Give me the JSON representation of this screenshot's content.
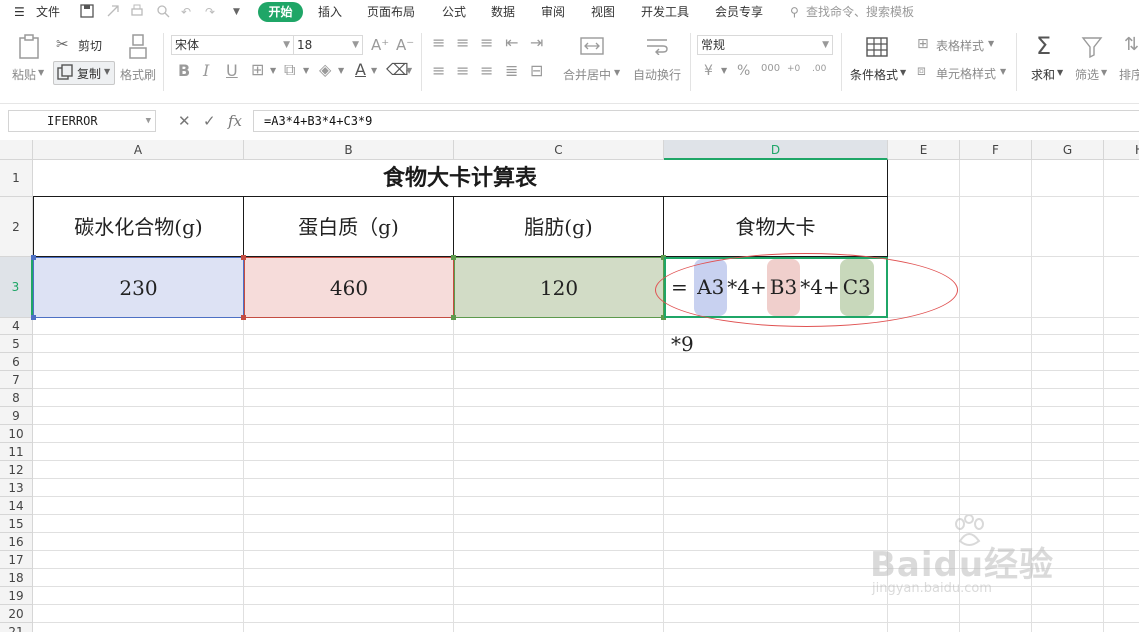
{
  "menu": {
    "file_label": "文件",
    "tabs": [
      "开始",
      "插入",
      "页面布局",
      "公式",
      "数据",
      "审阅",
      "视图",
      "开发工具",
      "会员专享"
    ],
    "search_placeholder": "查找命令、搜索模板"
  },
  "ribbon": {
    "paste": "粘贴",
    "cut": "剪切",
    "copy": "复制",
    "format_painter": "格式刷",
    "font_name": "宋体",
    "font_size": "18",
    "merge_center": "合并居中",
    "wrap_text": "自动换行",
    "number_format": "常规",
    "conditional_format": "条件格式",
    "table_style": "表格样式",
    "cell_style": "单元格样式",
    "sum": "求和",
    "filter": "筛选",
    "sort": "排序"
  },
  "formula_bar": {
    "name_box": "IFERROR",
    "fx": "fx",
    "formula": "=A3*4+B3*4+C3*9"
  },
  "sheet": {
    "columns": [
      "A",
      "B",
      "C",
      "D",
      "E",
      "F",
      "G",
      "H"
    ],
    "rows": [
      "1",
      "2",
      "3",
      "4",
      "5",
      "6",
      "7",
      "8",
      "9",
      "10",
      "11",
      "12",
      "13",
      "14",
      "15",
      "16",
      "17",
      "18",
      "19",
      "20",
      "21"
    ],
    "title": "食物大卡计算表",
    "headers": [
      "碳水化合物(g)",
      "蛋白质（g)",
      "脂肪(g)",
      "食物大卡"
    ],
    "values": [
      "230",
      "460",
      "120"
    ],
    "d3_formula": {
      "eq": "=",
      "ref1": "A3",
      "op1": "*4+",
      "ref2": "B3",
      "op2": "*4+",
      "ref3": "C3",
      "op3": "*9"
    }
  },
  "watermark": {
    "brand": "Baidu经验",
    "url": "jingyan.baidu.com"
  },
  "colors": {
    "accent": "#1fa667",
    "ref_a3": "#4d70c4",
    "ref_b3": "#c44d42",
    "ref_c3": "#5d9a4d",
    "annotation": "#e05252"
  }
}
